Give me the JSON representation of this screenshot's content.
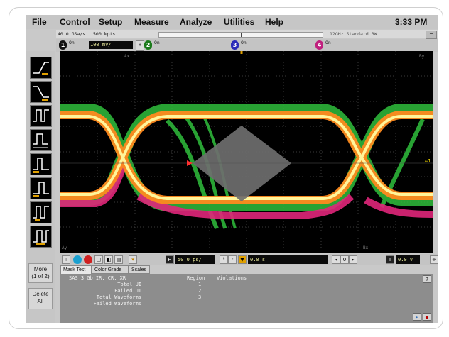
{
  "menu": {
    "items": [
      "File",
      "Control",
      "Setup",
      "Measure",
      "Analyze",
      "Utilities",
      "Help"
    ],
    "clock": "3:33 PM"
  },
  "status": {
    "sample_rate": "40.0 GSa/s",
    "points": "500 kpts",
    "bandwidth": "12GHz Standard BW",
    "minimize_glyph": "−"
  },
  "channels": [
    {
      "num": "1",
      "on": "On",
      "scale": "100 mV/",
      "color": "#111111"
    },
    {
      "num": "2",
      "on": "On",
      "color": "#1a7a1a"
    },
    {
      "num": "3",
      "on": "On",
      "color": "#2a2ab8"
    },
    {
      "num": "4",
      "on": "On",
      "color": "#c0207e"
    }
  ],
  "left_toolbar": {
    "more_label": "More",
    "more_sub": "(1 of 2)",
    "delete_label": "Delete",
    "delete_sub": "All"
  },
  "display": {
    "marker_ax": "Ax",
    "marker_bx": "Bx",
    "marker_ay": "Ay",
    "marker_by": "By",
    "marker_bottom_a": "Ay",
    "marker_bottom_b": "Bx",
    "right_marker": "←1"
  },
  "controls": {
    "timebase": "50.0 ps/",
    "delay": "0.0 s",
    "trigger_level": "0.0 V"
  },
  "tabs": [
    "Mask Test",
    "Color Grade",
    "Scales"
  ],
  "results": {
    "mask_name": "SAS 3 Gb IR, CR, XR",
    "rows": [
      {
        "label": "Total UI",
        "value": "1"
      },
      {
        "label": "Failed UI",
        "value": "2"
      },
      {
        "label": "Total Waveforms",
        "value": "3"
      },
      {
        "label": "Failed Waveforms",
        "value": ""
      }
    ],
    "col_region": "Region",
    "col_violations": "Violations",
    "scroll_label": "?"
  },
  "colors": {
    "trace_hot": "#fff59a",
    "trace_orange": "#ff8a1e",
    "trace_magenta": "#e0267a",
    "trace_green": "#2fbf3c",
    "mask": "#6e6e6e",
    "screen": "#000000"
  }
}
